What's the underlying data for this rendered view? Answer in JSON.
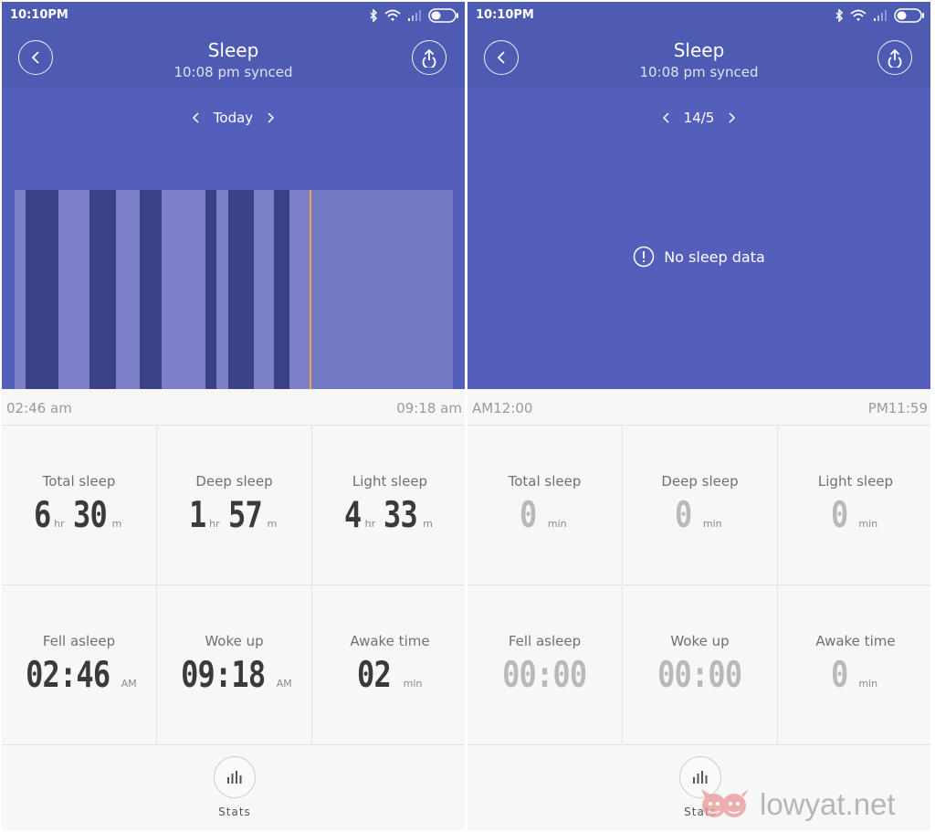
{
  "status_bar": {
    "time": "10:10PM"
  },
  "screens": [
    {
      "header": {
        "title": "Sleep",
        "subtitle": "10:08 pm synced"
      },
      "date_nav": {
        "label": "Today"
      },
      "chart": {
        "start_label": "02:46 am",
        "end_label": "09:18 am",
        "colors": {
          "deep": "#3a4185",
          "light": "#7b80c9",
          "now": "#e9a548"
        }
      },
      "metrics": [
        {
          "label": "Total sleep",
          "parts": [
            {
              "value": "6",
              "unit": "hr"
            },
            {
              "value": "30",
              "unit": "m"
            }
          ]
        },
        {
          "label": "Deep sleep",
          "parts": [
            {
              "value": "1",
              "unit": "hr"
            },
            {
              "value": "57",
              "unit": "m"
            }
          ]
        },
        {
          "label": "Light sleep",
          "parts": [
            {
              "value": "4",
              "unit": "hr"
            },
            {
              "value": "33",
              "unit": "m"
            }
          ]
        },
        {
          "label": "Fell asleep",
          "parts": [
            {
              "value": "02:46",
              "unit": "AM"
            }
          ]
        },
        {
          "label": "Woke up",
          "parts": [
            {
              "value": "09:18",
              "unit": "AM"
            }
          ]
        },
        {
          "label": "Awake time",
          "parts": [
            {
              "value": "02",
              "unit": "min"
            }
          ]
        }
      ],
      "stats_label": "Stats"
    },
    {
      "header": {
        "title": "Sleep",
        "subtitle": "10:08 pm synced"
      },
      "date_nav": {
        "label": "14/5"
      },
      "empty_message": "No sleep data",
      "chart": {
        "start_label": "AM12:00",
        "end_label": "PM11:59"
      },
      "metrics": [
        {
          "label": "Total sleep",
          "parts": [
            {
              "value": "0",
              "unit": "min"
            }
          ]
        },
        {
          "label": "Deep sleep",
          "parts": [
            {
              "value": "0",
              "unit": "min"
            }
          ]
        },
        {
          "label": "Light sleep",
          "parts": [
            {
              "value": "0",
              "unit": "min"
            }
          ]
        },
        {
          "label": "Fell asleep",
          "parts": [
            {
              "value": "00:00"
            }
          ]
        },
        {
          "label": "Woke up",
          "parts": [
            {
              "value": "00:00"
            }
          ]
        },
        {
          "label": "Awake time",
          "parts": [
            {
              "value": "0",
              "unit": "min"
            }
          ]
        }
      ],
      "stats_label": "Stats"
    }
  ],
  "watermark": {
    "text": "lowyat.net"
  }
}
